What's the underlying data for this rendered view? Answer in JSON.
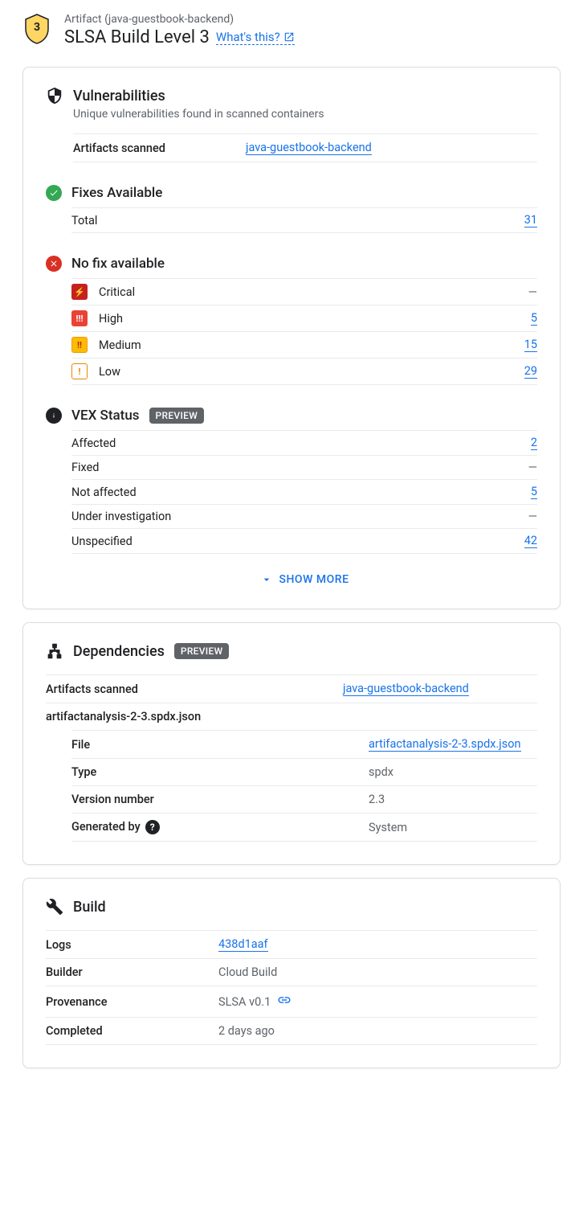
{
  "header": {
    "artifact_label": "Artifact (java-guestbook-backend)",
    "slsa_title": "SLSA Build Level 3",
    "whats_this": "What's this?"
  },
  "vulnerabilities": {
    "title": "Vulnerabilities",
    "subtitle": "Unique vulnerabilities found in scanned containers",
    "artifacts_scanned_label": "Artifacts scanned",
    "artifacts_scanned_value": "java-guestbook-backend",
    "fixes_available": {
      "title": "Fixes Available",
      "total_label": "Total",
      "total_value": "31"
    },
    "no_fix": {
      "title": "No fix available",
      "rows": [
        {
          "label": "Critical",
          "value": "—",
          "is_link": false
        },
        {
          "label": "High",
          "value": "5",
          "is_link": true
        },
        {
          "label": "Medium",
          "value": "15",
          "is_link": true
        },
        {
          "label": "Low",
          "value": "29",
          "is_link": true
        }
      ]
    },
    "vex": {
      "title": "VEX Status",
      "badge": "PREVIEW",
      "rows": [
        {
          "label": "Affected",
          "value": "2",
          "is_link": true
        },
        {
          "label": "Fixed",
          "value": "—",
          "is_link": false
        },
        {
          "label": "Not affected",
          "value": "5",
          "is_link": true
        },
        {
          "label": "Under investigation",
          "value": "—",
          "is_link": false
        },
        {
          "label": "Unspecified",
          "value": "42",
          "is_link": true
        }
      ]
    },
    "show_more": "SHOW MORE"
  },
  "dependencies": {
    "title": "Dependencies",
    "badge": "PREVIEW",
    "artifacts_scanned_label": "Artifacts scanned",
    "artifacts_scanned_value": "java-guestbook-backend",
    "spdx_header": "artifactanalysis-2-3.spdx.json",
    "rows": [
      {
        "key": "File",
        "value": "artifactanalysis-2-3.spdx.json",
        "is_link": true
      },
      {
        "key": "Type",
        "value": "spdx",
        "is_link": false
      },
      {
        "key": "Version number",
        "value": "2.3",
        "is_link": false
      },
      {
        "key": "Generated by",
        "value": "System",
        "is_link": false,
        "help": true
      }
    ]
  },
  "build": {
    "title": "Build",
    "rows": [
      {
        "key": "Logs",
        "value": "438d1aaf",
        "is_link": true
      },
      {
        "key": "Builder",
        "value": "Cloud Build",
        "is_link": false
      },
      {
        "key": "Provenance",
        "value": "SLSA v0.1",
        "is_link": false,
        "chain": true
      },
      {
        "key": "Completed",
        "value": "2 days ago",
        "is_link": false
      }
    ]
  }
}
